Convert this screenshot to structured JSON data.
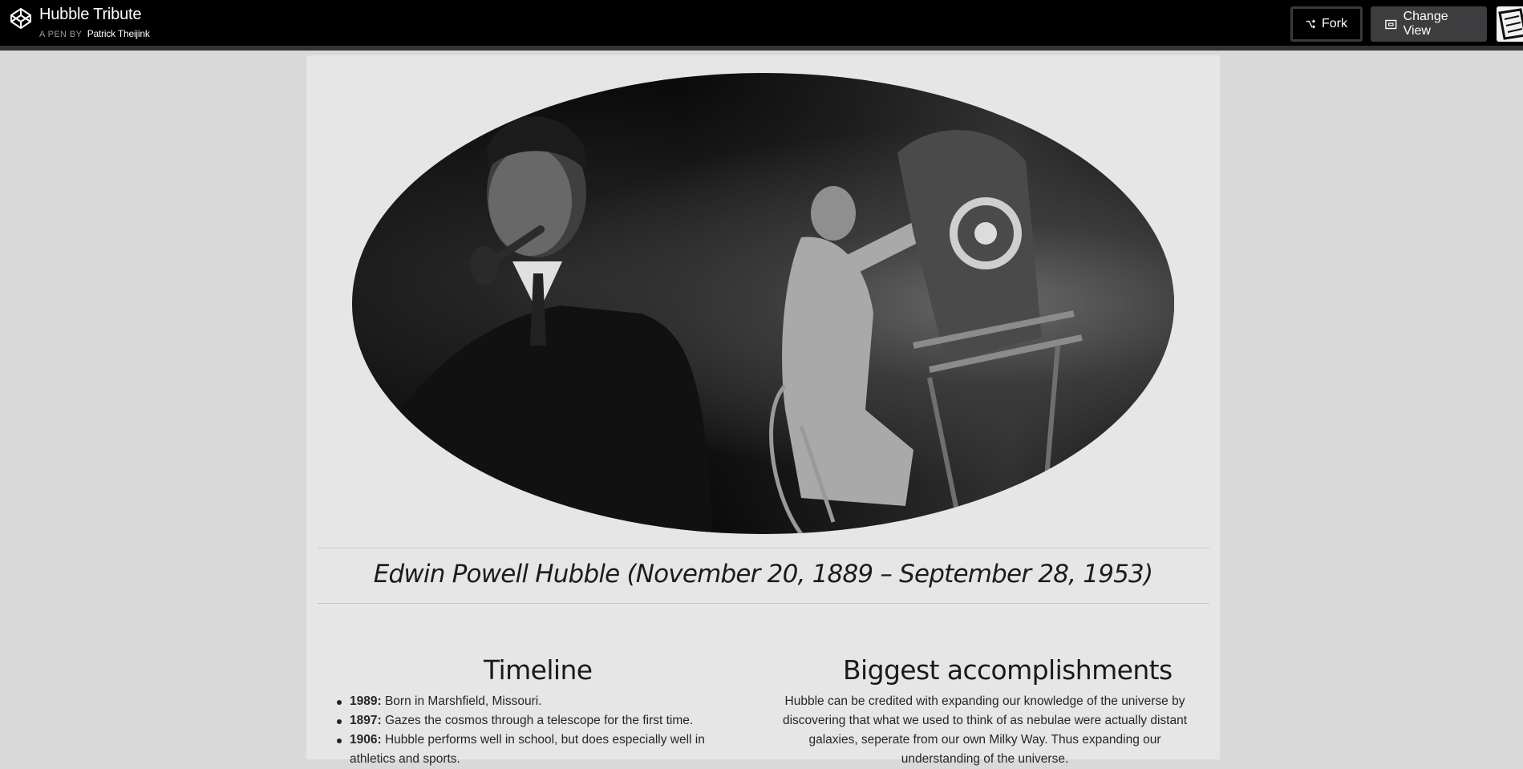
{
  "header": {
    "title": "Hubble Tribute",
    "author_prefix": "A PEN BY",
    "author_name": "Patrick Theijink",
    "fork_label": "Fork",
    "change_view_label": "Change View"
  },
  "page": {
    "headline": "Edwin Powell Hubble (November 20, 1889 – September 28, 1953)",
    "timeline": {
      "title": "Timeline",
      "items": [
        {
          "year": "1989:",
          "text": " Born in Marshfield, Missouri."
        },
        {
          "year": "1897:",
          "text": " Gazes the cosmos through a telescope for the first time."
        },
        {
          "year": "1906:",
          "text": " Hubble performs well in school, but does especially well in athletics and sports."
        }
      ]
    },
    "accomplishments": {
      "title": "Biggest accomplishments",
      "text": "Hubble can be credited with expanding our knowledge of the universe by discovering that what we used to think of as nebulae were actually distant galaxies, seperate from our own Milky Way. Thus expanding our understanding of the universe."
    }
  }
}
